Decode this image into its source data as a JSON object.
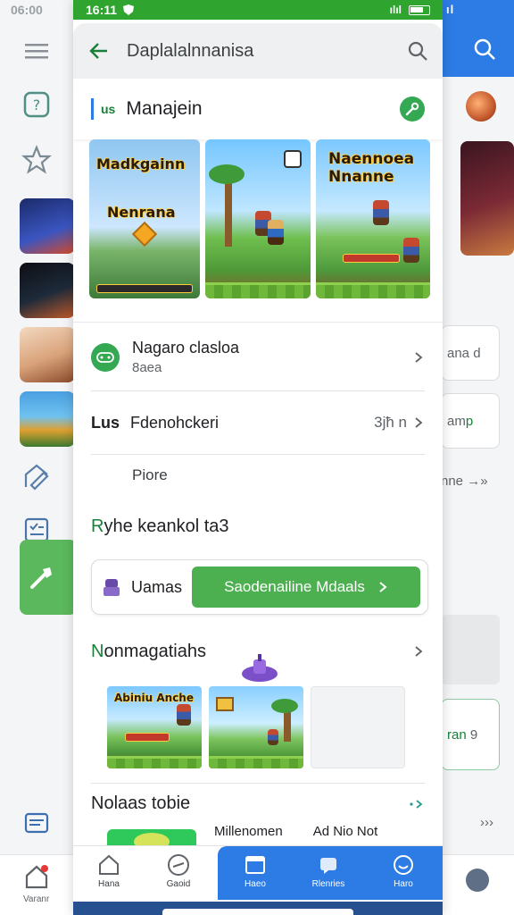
{
  "left_app": {
    "status_time": "06:00",
    "bottom_label": "Varanr"
  },
  "right_app": {
    "card1_text": "ana d",
    "card2_text": "am",
    "card2_accent": "p",
    "row_text": "nne",
    "row_arrow": "→»",
    "card3_text": "ran",
    "card3_accent": "9",
    "bottom_arrow": "›››"
  },
  "status_bar": {
    "time": "16:11",
    "signal_text": "ılıl",
    "signal2_text": "ıl"
  },
  "topbar": {
    "title": "Daplalalnnanisa"
  },
  "app_row": {
    "prefix": "us",
    "name": "Manajein"
  },
  "screenshots": {
    "shot1_title": "Madkgainn",
    "shot1_subtitle": "Nenrana",
    "shot3_title": "Naennoea Nnanne"
  },
  "rows": {
    "row1_title": "Nagaro clasloa",
    "row1_subtitle": "8aea",
    "row2_label": "Lus",
    "row2_value": "Fdenohckeri",
    "row2_meta": "3jħ n",
    "row3_text": "Piore"
  },
  "section1": {
    "accent": "R",
    "title": "yhe keankol ta3"
  },
  "install_card": {
    "name": "Uamas",
    "button_label": "Saodenailine Mdaals"
  },
  "section2": {
    "accent": "N",
    "title": "onmagatiahs"
  },
  "games": {
    "game1_title": "Abiniu Anche"
  },
  "section3": {
    "title": "Nolaas tobie"
  },
  "bottom_texts": {
    "left": "Millenomen",
    "right": "Ad Nio Not"
  },
  "bottom_nav": {
    "items": [
      {
        "label": "Hana"
      },
      {
        "label": "Gaoid"
      },
      {
        "label": "Haeo"
      },
      {
        "label": "Rlenries"
      },
      {
        "label": "Haro"
      }
    ]
  },
  "colors": {
    "green": "#2fa52f",
    "blue": "#2d7ce5",
    "button_green": "#4caf50"
  }
}
